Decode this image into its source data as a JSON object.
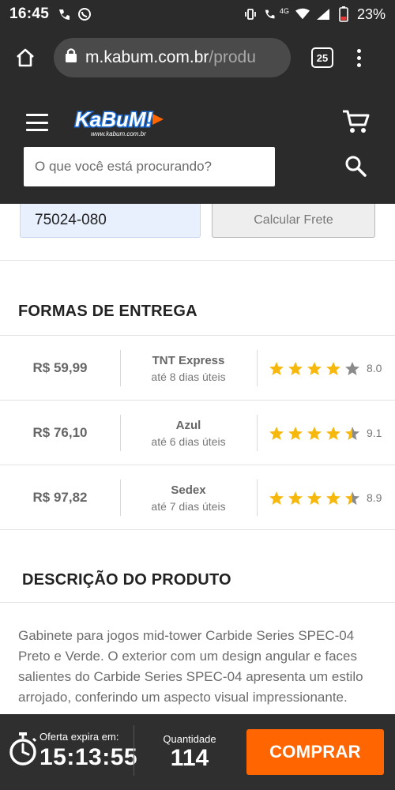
{
  "status_bar": {
    "time": "16:45",
    "network": "4G",
    "battery": "23%"
  },
  "browser": {
    "url_domain": "m.kabum.com.br",
    "url_path": "/produ",
    "tab_count": "25"
  },
  "header": {
    "logo_text": "KaBuM!",
    "logo_sub": "www.kabum.com.br",
    "search_placeholder": "O que você está procurando?"
  },
  "shipping": {
    "cep_value": "75024-080",
    "calc_button": "Calcular Frete"
  },
  "delivery": {
    "title": "FORMAS DE ENTREGA",
    "options": [
      {
        "price": "R$ 59,99",
        "carrier": "TNT Express",
        "eta": "até 8 dias úteis",
        "rating": "8.0",
        "stars": 4.0
      },
      {
        "price": "R$ 76,10",
        "carrier": "Azul",
        "eta": "até 6 dias úteis",
        "rating": "9.1",
        "stars": 4.5
      },
      {
        "price": "R$ 97,82",
        "carrier": "Sedex",
        "eta": "até 7 dias úteis",
        "rating": "8.9",
        "stars": 4.5
      }
    ]
  },
  "description": {
    "title": "DESCRIÇÃO DO PRODUTO",
    "text": "Gabinete para jogos mid-tower Carbide Series SPEC-04 Preto e Verde. O exterior com um design angular e faces salientes do Carbide Series SPEC-04 apresenta um estilo arrojado, conferindo um aspecto visual impressionante."
  },
  "bottom_bar": {
    "offer_label": "Oferta expira em:",
    "offer_time": "15:13:55",
    "qty_label": "Quantidade",
    "qty_value": "114",
    "buy_button": "COMPRAR"
  },
  "colors": {
    "dark_bg": "#2b2b2b",
    "accent_orange": "#ff6500",
    "star_gold": "#f6b80c",
    "star_gray": "#8a8a8a",
    "logo_blue": "#1e6fd9"
  }
}
